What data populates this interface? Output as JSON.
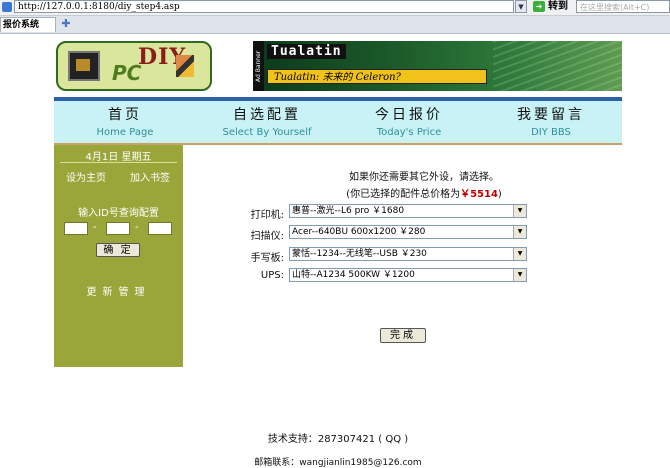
{
  "browser": {
    "url": "http://127.0.0.1:8180/diy_step4.asp",
    "go_label": "转到",
    "search_placeholder": "在这里搜索(Alt+C)",
    "tab_title": "报价系统"
  },
  "header": {
    "logo_text_top": "DIY",
    "logo_text_bottom": "PC",
    "banner_side": "Ad Banner",
    "banner_title": "Tualatin",
    "banner_slogan": "Tualatin: 未来的 Celeron?"
  },
  "nav": [
    {
      "cn": "首页",
      "en": "Home Page"
    },
    {
      "cn": "自选配置",
      "en": "Select By Yourself"
    },
    {
      "cn": "今日报价",
      "en": "Today's Price"
    },
    {
      "cn": "我要留言",
      "en": "DIY BBS"
    }
  ],
  "sidebar": {
    "date": "4月1日 星期五",
    "set_home": "设为主页",
    "bookmark": "加入书签",
    "id_query_label": "输入ID号查询配置",
    "id_sep": "-",
    "ok_label": "确 定",
    "admin": "更新管理"
  },
  "main": {
    "intro": "如果你还需要其它外设，请选择。",
    "total_prefix": "(你已选择的配件总价格为",
    "total_value": "￥5514",
    "total_suffix": ")",
    "rows": [
      {
        "label": "打印机:",
        "value": "惠普--激光--L6 pro  ￥1680"
      },
      {
        "label": "扫描仪:",
        "value": "Acer--640BU  600x1200  ￥280"
      },
      {
        "label": "手写板:",
        "value": "蒙恬--1234--无线笔--USB  ￥230"
      },
      {
        "label": "UPS:",
        "value": "山特--A1234  500KW  ￥1200"
      }
    ],
    "done_label": "完成"
  },
  "footer": {
    "support": "技术支持：287307421 ( QQ )",
    "email": "邮箱联系：wangjianlin1985@126.com"
  },
  "colors": {
    "nav_bg": "#c8f2f6",
    "sidebar_bg": "#9aa63a",
    "nav_rule": "#2e60a8",
    "price_red": "#c00000"
  }
}
